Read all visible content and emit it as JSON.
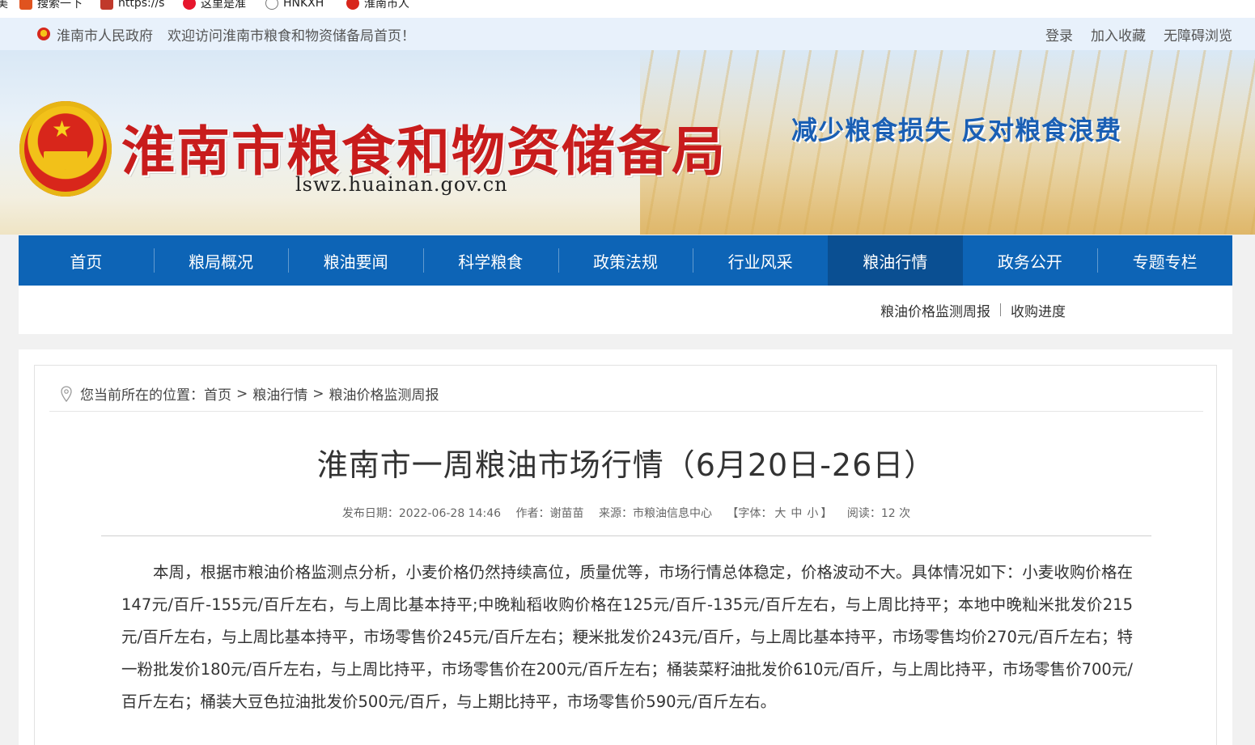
{
  "browser": {
    "bookmarks": [
      {
        "label": "搜索一下",
        "icon": "hao-icon",
        "color": "#e0531f"
      },
      {
        "label": "https://s",
        "icon": "page-icon",
        "color": "#c0392b"
      },
      {
        "label": "这里是准",
        "icon": "weibo-icon",
        "color": "#e6162d"
      },
      {
        "label": "HNKXH",
        "icon": "globe-icon",
        "color": "#777777"
      },
      {
        "label": "淮南市人",
        "icon": "emblem-icon",
        "color": "#d8261b"
      }
    ]
  },
  "topbar": {
    "gov_link": "淮南市人民政府",
    "welcome": "欢迎访问淮南市粮食和物资储备局首页！",
    "login": "登录",
    "favorite": "加入收藏",
    "accessible": "无障碍浏览"
  },
  "banner": {
    "title": "淮南市粮食和物资储备局",
    "domain": "lswz.huainan.gov.cn",
    "slogan": "减少粮食损失  反对粮食浪费"
  },
  "nav": {
    "items": [
      "首页",
      "粮局概况",
      "粮油要闻",
      "科学粮食",
      "政策法规",
      "行业风采",
      "粮油行情",
      "政务公开",
      "专题专栏"
    ],
    "active": "粮油行情"
  },
  "subnav": {
    "links": [
      "粮油价格监测周报",
      "收购进度"
    ]
  },
  "breadcrumb": {
    "prefix": "您当前所在的位置：",
    "items": [
      "首页",
      "粮油行情",
      "粮油价格监测周报"
    ],
    "separator": ">"
  },
  "article": {
    "title": "淮南市一周粮油市场行情（6月20日-26日）",
    "publish_date": "发布日期：2022-06-28 14:46",
    "author": "作者：谢苗苗",
    "source": "来源：市粮油信息中心",
    "font_label": "【字体：",
    "font_sizes": [
      "大",
      "中",
      "小"
    ],
    "font_close": "】",
    "views": "阅读：12 次",
    "body": "本周，根据市粮油价格监测点分析，小麦价格仍然持续高位，质量优等，市场行情总体稳定，价格波动不大。具体情况如下：小麦收购价格在147元/百斤-155元/百斤左右，与上周比基本持平;中晚籼稻收购价格在125元/百斤-135元/百斤左右，与上周比持平；本地中晚籼米批发价215元/百斤左右，与上周比基本持平，市场零售价245元/百斤左右；粳米批发价243元/百斤，与上周比基本持平，市场零售均价270元/百斤左右；特一粉批发价180元/百斤左右，与上周比持平，市场零售价在200元/百斤左右；桶装菜籽油批发价610元/百斤，与上周比持平，市场零售价700元/百斤左右；桶装大豆色拉油批发价500元/百斤，与上期比持平，市场零售价590元/百斤左右。"
  }
}
